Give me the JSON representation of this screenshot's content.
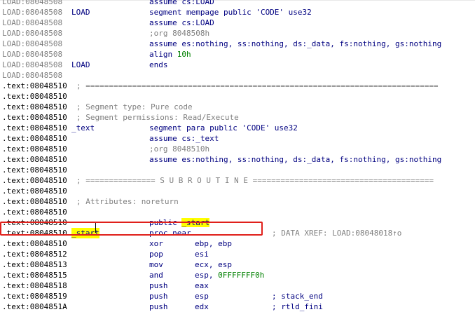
{
  "listing": [
    {
      "addr": "LOAD:08048508",
      "label": "",
      "dir": "assume cs:LOAD"
    },
    {
      "addr": "LOAD:08048508",
      "label": "LOAD",
      "dir": "segment mempage public 'CODE' use32"
    },
    {
      "addr": "LOAD:08048508",
      "label": "",
      "dir": "assume cs:LOAD"
    },
    {
      "addr": "LOAD:08048508",
      "label": "",
      "cmt": ";org 8048508h"
    },
    {
      "addr": "LOAD:08048508",
      "label": "",
      "dir": "assume es:nothing, ss:nothing, ds:_data, fs:nothing, gs:nothing"
    },
    {
      "addr": "LOAD:08048508",
      "label": "",
      "dir": "align",
      "num": "10h"
    },
    {
      "addr": "LOAD:08048508",
      "label": "LOAD",
      "dir": "ends"
    },
    {
      "addr": "LOAD:08048508"
    },
    {
      "addr": ".text:08048510",
      "sep": "; ============================================================================"
    },
    {
      "addr": ".text:08048510"
    },
    {
      "addr": ".text:08048510",
      "sep": "; Segment type: Pure code"
    },
    {
      "addr": ".text:08048510",
      "sep": "; Segment permissions: Read/Execute"
    },
    {
      "addr": ".text:08048510",
      "label": "_text",
      "dir": "segment para public 'CODE' use32"
    },
    {
      "addr": ".text:08048510",
      "dir": "assume cs:_text"
    },
    {
      "addr": ".text:08048510",
      "cmt": ";org 8048510h"
    },
    {
      "addr": ".text:08048510",
      "dir": "assume es:nothing, ss:nothing, ds:_data, fs:nothing, gs:nothing"
    },
    {
      "addr": ".text:08048510"
    },
    {
      "addr": ".text:08048510",
      "sep": "; =============== S U B R O U T I N E ======================================="
    },
    {
      "addr": ".text:08048510"
    },
    {
      "addr": ".text:08048510",
      "sep": "; Attributes: noreturn"
    },
    {
      "addr": ".text:08048510"
    },
    {
      "addr": ".text:08048510",
      "public": "public",
      "public_name": "_start"
    },
    {
      "addr": ".text:08048510",
      "label": "_start",
      "mn": "proc near",
      "xref": "; DATA XREF: LOAD:08048018↑o"
    },
    {
      "addr": ".text:08048510",
      "mn": "xor",
      "ops": "ebp, ebp"
    },
    {
      "addr": ".text:08048512",
      "mn": "pop",
      "ops": "esi"
    },
    {
      "addr": ".text:08048513",
      "mn": "mov",
      "ops": "ecx, esp"
    },
    {
      "addr": ".text:08048515",
      "mn": "and",
      "ops": "esp, ",
      "num": "0FFFFFFF0h"
    },
    {
      "addr": ".text:08048518",
      "mn": "push",
      "ops": "eax"
    },
    {
      "addr": ".text:08048519",
      "mn": "push",
      "ops": "esp",
      "rcmt": "; stack_end"
    },
    {
      "addr": ".text:0804851A",
      "mn": "push",
      "ops": "edx",
      "rcmt": "; rtld_fini"
    }
  ]
}
